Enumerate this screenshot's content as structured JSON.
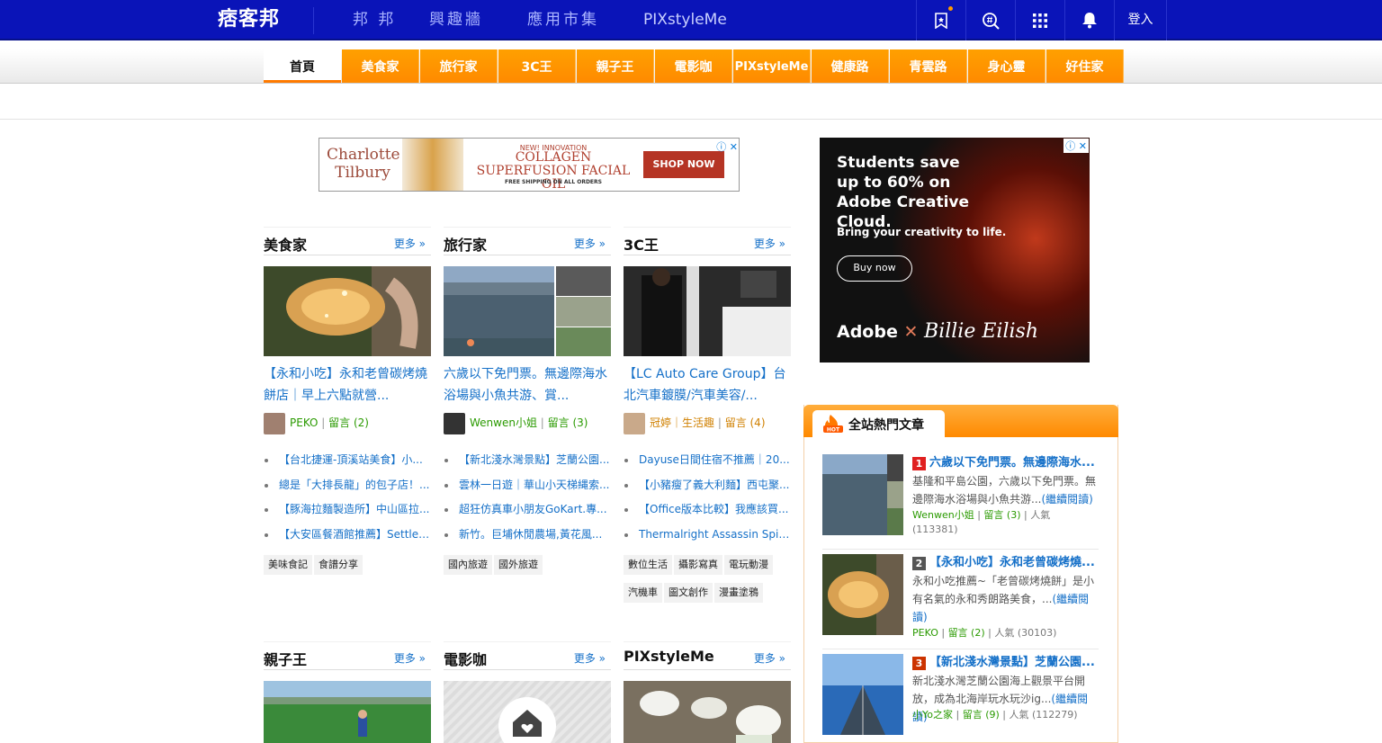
{
  "topbar": {
    "logo": "痞客邦",
    "nav": [
      "邦 邦",
      "興趣牆",
      "應用市集",
      "PIXstyleMe"
    ],
    "login": "登入",
    "icons": [
      "bookmark-icon",
      "search-icon",
      "apps-grid-icon",
      "bell-icon"
    ]
  },
  "categories": [
    "首頁",
    "美食家",
    "旅行家",
    "3C王",
    "親子王",
    "電影咖",
    "PIXstyleMe",
    "健康路",
    "青雲路",
    "身心靈",
    "好住家"
  ],
  "ad_top": {
    "brand": "Charlotte Tilbury",
    "line1": "NEW! INNOVATION",
    "line2": "COLLAGEN SUPERFUSION FACIAL OIL",
    "line3": "FREE SHIPPING ON ALL ORDERS",
    "cta": "SHOP NOW"
  },
  "ad_side": {
    "headline": "Students save up to 60% on Adobe Creative Cloud.",
    "sub": "Bring your creativity to life.",
    "cta": "Buy now",
    "brand1": "Adobe",
    "brand2": "Billie Eilish"
  },
  "more_label": "更多 »",
  "columns": [
    {
      "title": "美食家",
      "post_title": "【永和小吃】永和老曾碳烤燒餅店｜早上六點就營...",
      "author": "PEKO",
      "comments": "留言 (2)",
      "list": [
        "【台北捷運-頂溪站美食】小...",
        "總是「大排長龍」的包子店！...",
        "【豚海拉麵製造所】中山區拉...",
        "【大安區餐酒館推薦】Settle ..."
      ],
      "tags": [
        "美味食記",
        "食譜分享"
      ]
    },
    {
      "title": "旅行家",
      "post_title": "六歲以下免門票。無邊際海水浴場與小魚共游、賞...",
      "author": "Wenwen小姐",
      "comments": "留言 (3)",
      "list": [
        "【新北淺水灣景點】芝蘭公園...",
        "雲林一日遊｜華山小天梯縄索...",
        "超狂仿真車小朋友GoKart.專...",
        "新竹。巨埔休閒農場,黃花風..."
      ],
      "tags": [
        "國內旅遊",
        "國外旅遊"
      ]
    },
    {
      "title": "3C王",
      "post_title": "【LC Auto Care Group】台北汽車鍍膜/汽車美容/...",
      "author": "冠婷｜生活趣",
      "comments": "留言 (4)",
      "list": [
        "Dayuse日間住宿不推薦｜20...",
        "【小豬瘦了義大利麵】西屯聚...",
        "【Office版本比較】我應該買...",
        "Thermalright Assassin Spirit ..."
      ],
      "tags": [
        "數位生活",
        "攝影寫真",
        "電玩動漫",
        "汽機車",
        "圖文創作",
        "漫畫塗鴉"
      ]
    }
  ],
  "columns2": [
    {
      "title": "親子王"
    },
    {
      "title": "電影咖"
    },
    {
      "title": "PIXstyleMe"
    }
  ],
  "hot": {
    "title": "全站熱門文章",
    "items": [
      {
        "rank": "1",
        "title": "六歲以下免門票。無邊際海水...",
        "desc": "基隆和平島公園，六歲以下免門票。無邊際海水浴場與小魚共游...",
        "read": "(繼續閱讀)",
        "author": "Wenwen小姐",
        "comments": "留言 (3)",
        "pop": "人氣 (113381)",
        "rank_color": "#e02020"
      },
      {
        "rank": "2",
        "title": "【永和小吃】永和老曾碳烤燒...",
        "desc": "永和小吃推薦~「老曾碳烤燒餅」是小有名氣的永和秀朗路美食，...",
        "read": "(繼續閱讀)",
        "author": "PEKO",
        "comments": "留言 (2)",
        "pop": "人氣 (30103)",
        "rank_color": "#555555"
      },
      {
        "rank": "3",
        "title": "【新北淺水灣景點】芝蘭公園...",
        "desc": "新北淺水灣芝蘭公園海上觀景平台開放，成為北海岸玩水玩沙ig...",
        "read": "(繼續閱讀)",
        "author": "小Yo之家",
        "comments": "留言 (9)",
        "pop": "人氣 (112279)",
        "rank_color": "#cc3300"
      }
    ]
  },
  "colors": {
    "topbar": "#0a14b8",
    "orange": "#ff8a00",
    "link": "#1570c8",
    "author": "#2a9a00"
  }
}
